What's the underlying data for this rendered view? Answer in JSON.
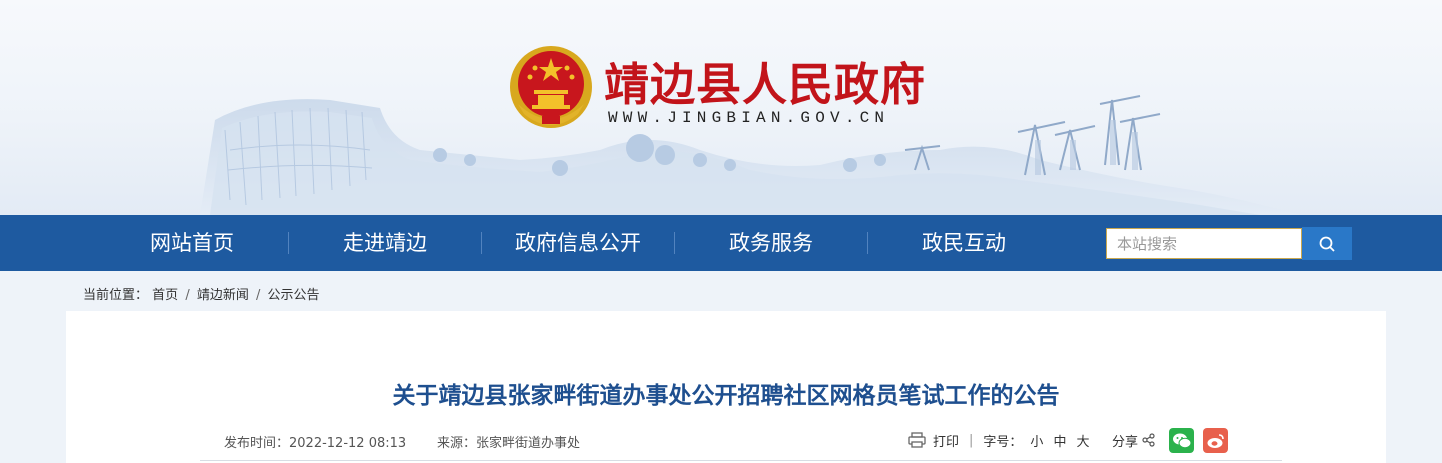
{
  "header": {
    "site_name": "靖边县人民政府",
    "site_url": "WWW.JINGBIAN.GOV.CN",
    "emblem_icon": "national-emblem-icon",
    "brand_color": "#c2141a"
  },
  "nav": {
    "items": [
      {
        "label": "网站首页"
      },
      {
        "label": "走进靖边"
      },
      {
        "label": "政府信息公开"
      },
      {
        "label": "政务服务"
      },
      {
        "label": "政民互动"
      }
    ],
    "background_color": "#1e5aa0",
    "search": {
      "placeholder": "本站搜索",
      "icon": "search-icon"
    }
  },
  "breadcrumb": {
    "prefix": "当前位置：",
    "items": [
      "首页",
      "靖边新闻",
      "公示公告"
    ],
    "separator": "/"
  },
  "article": {
    "title": "关于靖边县张家畔街道办事处公开招聘社区网格员笔试工作的公告",
    "publish_label": "发布时间：",
    "publish_time": "2022-12-12 08:13",
    "source_label": "来源：",
    "source": "张家畔街道办事处",
    "print_label": "打印",
    "font_size_label": "字号：",
    "font_sizes": [
      "小",
      "中",
      "大"
    ],
    "share_label": "分享",
    "share_icons": [
      "wechat-icon",
      "weibo-icon"
    ],
    "title_color": "#1e4f8f"
  }
}
